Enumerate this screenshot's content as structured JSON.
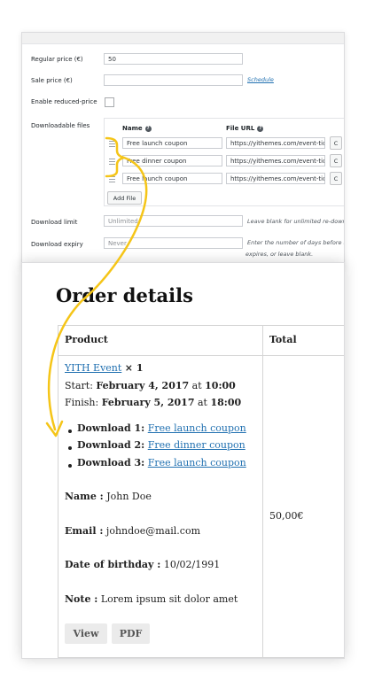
{
  "admin": {
    "regular_price_label": "Regular price (€)",
    "regular_price_value": "50",
    "sale_price_label": "Sale price (€)",
    "schedule_link": "Schedule",
    "enable_reduced_label": "Enable reduced-price",
    "downloadable_files_label": "Downloadable files",
    "col_name": "Name",
    "col_file_url": "File URL",
    "files": [
      {
        "name": "Free launch coupon",
        "url": "https://yithemes.com/event-tic",
        "btn": "C"
      },
      {
        "name": "Free dinner coupon",
        "url": "https://yithemes.com/event-tic",
        "btn": "C"
      },
      {
        "name": "Free launch coupon",
        "url": "https://yithemes.com/event-tic",
        "btn": "C"
      }
    ],
    "add_file_label": "Add File",
    "download_limit_label": "Download limit",
    "download_limit_placeholder": "Unlimited",
    "download_limit_hint": "Leave blank for unlimited re-down",
    "download_expiry_label": "Download expiry",
    "download_expiry_placeholder": "Never",
    "download_expiry_hint_1": "Enter the number of days before a",
    "download_expiry_hint_2": "expires, or leave blank."
  },
  "order": {
    "title": "Order details",
    "col_product": "Product",
    "col_total": "Total",
    "product_link": "YITH Event",
    "quantity": "× 1",
    "start_label": "Start:",
    "start_date": "February 4, 2017",
    "start_at": "at",
    "start_time": "10:00",
    "finish_label": "Finish:",
    "finish_date": "February 5, 2017",
    "finish_at": "at",
    "finish_time": "18:00",
    "downloads": [
      {
        "label": "Download 1:",
        "link": "Free launch coupon"
      },
      {
        "label": "Download 2:",
        "link": "Free dinner coupon"
      },
      {
        "label": "Download 3:",
        "link": "Free launch coupon"
      }
    ],
    "name_label": "Name :",
    "name_value": "John Doe",
    "email_label": "Email :",
    "email_value": "johndoe@mail.com",
    "birthday_label": "Date of birthday :",
    "birthday_value": "10/02/1991",
    "note_label": "Note :",
    "note_value": "Lorem ipsum sit dolor amet",
    "view_button": "View",
    "pdf_button": "PDF",
    "total_value": "50,00€"
  },
  "colors": {
    "link": "#2271b1",
    "arrow": "#f5c518"
  }
}
